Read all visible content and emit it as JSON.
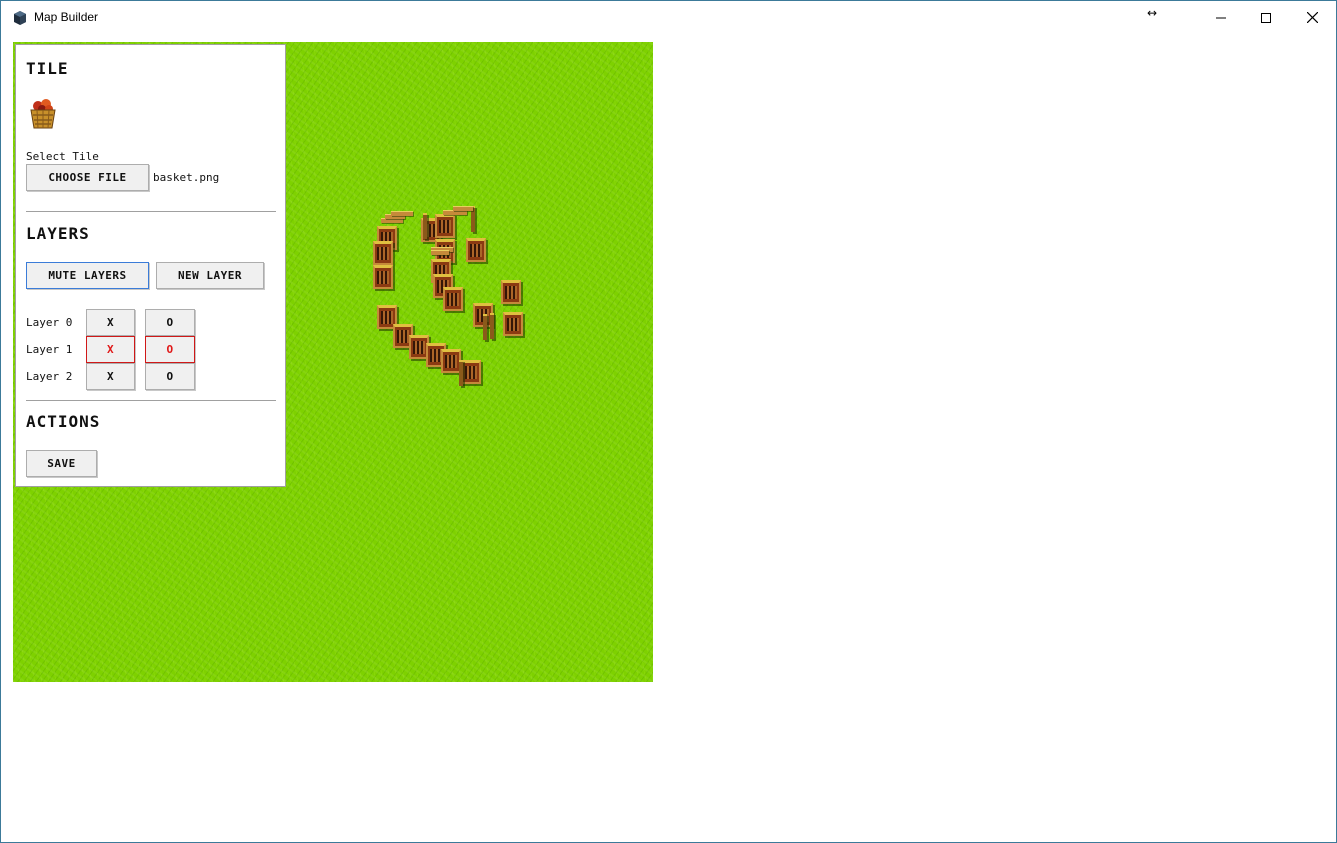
{
  "window": {
    "title": "Map Builder",
    "icons": [
      "app-icon",
      "resize-arrows-icon",
      "minimize-icon",
      "maximize-icon",
      "close-icon"
    ]
  },
  "panel": {
    "tile": {
      "heading": "TILE",
      "preview_icon": "basket-icon",
      "select_label": "Select Tile",
      "choose_button": "CHOOSE FILE",
      "file_name": "basket.png"
    },
    "layers": {
      "heading": "LAYERS",
      "mute_button": "MUTE LAYERS",
      "new_button": "NEW LAYER",
      "items": [
        {
          "label": "Layer 0",
          "x": "X",
          "o": "O",
          "active": false
        },
        {
          "label": "Layer 1",
          "x": "X",
          "o": "O",
          "active": true
        },
        {
          "label": "Layer 2",
          "x": "X",
          "o": "O",
          "active": false
        }
      ]
    },
    "actions": {
      "heading": "ACTIONS",
      "save_button": "SAVE"
    }
  },
  "map": {
    "tile_icon": "crate-icon",
    "colors": {
      "grass": "#7ed100",
      "active_layer": "#e01818",
      "focus": "#3b7cd8"
    }
  }
}
